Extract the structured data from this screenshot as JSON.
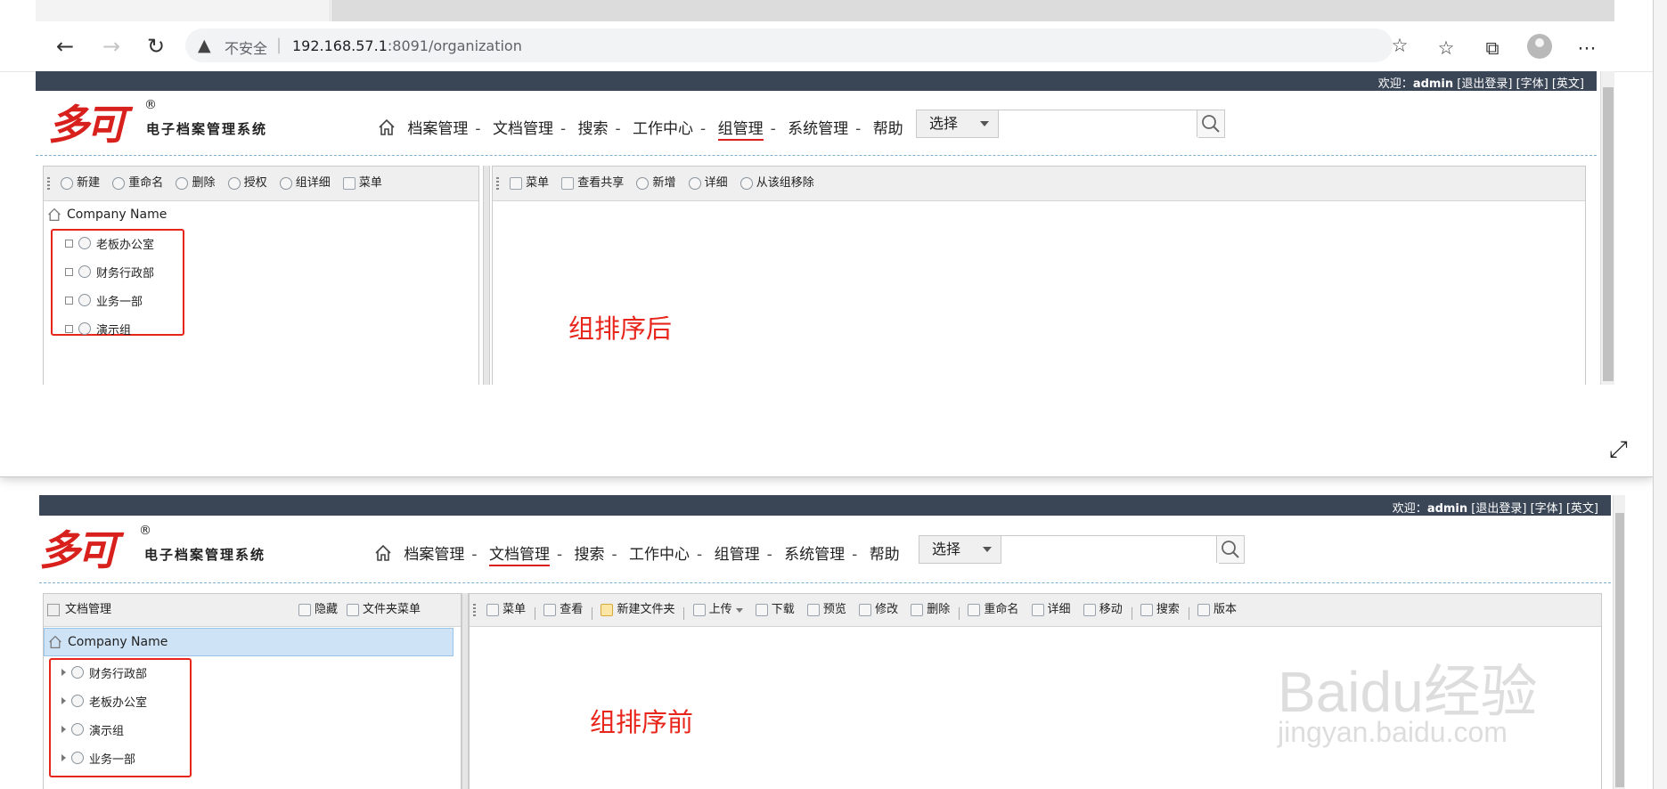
{
  "browser": {
    "insecure_label": "不安全",
    "url_host": "192.168.57.1",
    "url_rest": ":8091/organization"
  },
  "app": {
    "welcome_prefix": "欢迎：",
    "user": "admin",
    "links": "[退出登录]   [字体]   [英文]",
    "logo_text": "多可",
    "logo_reg": "®",
    "logo_subtitle": "电子档案管理系统",
    "search_select": "选择",
    "search_placeholder": ""
  },
  "nav": {
    "items": [
      "档案管理",
      "文档管理",
      "搜索",
      "工作中心",
      "组管理",
      "系统管理",
      "帮助"
    ],
    "sep": "-"
  },
  "top_view": {
    "active_nav_index": 4,
    "left_toolbar": [
      "新建",
      "重命名",
      "删除",
      "授权",
      "组详细",
      "菜单"
    ],
    "right_toolbar": [
      "菜单",
      "查看共享",
      "新增",
      "详细",
      "从该组移除"
    ],
    "root": "Company Name",
    "groups": [
      "老板办公室",
      "财务行政部",
      "业务一部",
      "演示组"
    ],
    "annotation": "组排序后"
  },
  "bottom_view": {
    "active_nav_index": 1,
    "panel_title": "文档管理",
    "hide_label": "隐藏",
    "folder_menu_label": "文件夹菜单",
    "right_toolbar": [
      "菜单",
      "查看",
      "新建文件夹",
      "上传",
      "下载",
      "预览",
      "修改",
      "删除",
      "重命名",
      "详细",
      "移动",
      "搜索",
      "版本"
    ],
    "root": "Company Name",
    "groups": [
      "财务行政部",
      "老板办公室",
      "演示组",
      "业务一部"
    ],
    "annotation": "组排序前"
  },
  "watermark": {
    "brand": "Baidu经验",
    "domain": "jingyan.baidu.com"
  },
  "colors": {
    "app_bar": "#3a4556",
    "logo_red": "#d8201d",
    "highlight_box": "#e8251b",
    "selected_row": "#cfe3f7"
  },
  "icons": {
    "browser": [
      "back-icon",
      "forward-icon",
      "refresh-icon",
      "warning-icon",
      "favorite-add-icon",
      "favorites-icon",
      "collections-icon",
      "profile-avatar",
      "more-icon",
      "expand-icon"
    ],
    "app": [
      "home-icon",
      "search-icon",
      "caret-down-icon",
      "people-icon",
      "checkbox-icon",
      "expand-triangle-icon"
    ]
  }
}
